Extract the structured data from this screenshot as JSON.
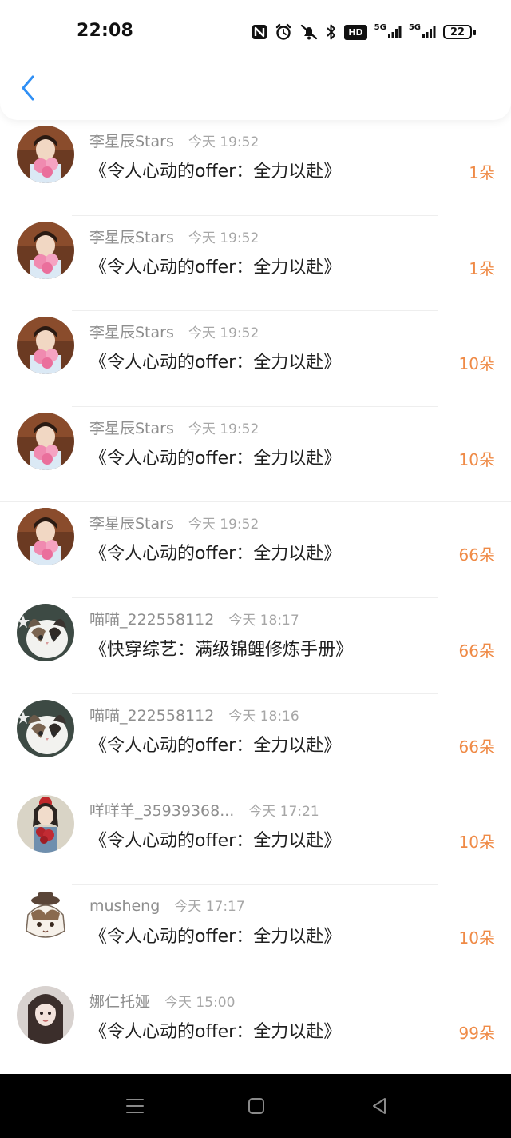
{
  "status_bar": {
    "time": "22:08",
    "icons": [
      "nfc-icon",
      "alarm-icon",
      "mute-icon",
      "bluetooth-icon",
      "hd-icon",
      "5g-signal-icon",
      "5g-signal-icon",
      "battery-icon"
    ],
    "hd_text": "HD",
    "net1_text": "5G",
    "net2_text": "5G",
    "battery_level": "22"
  },
  "nav": {
    "back_icon": "chevron-left-icon",
    "accent_color": "#2f8ff5"
  },
  "colors": {
    "count": "#ef8a46",
    "username": "#8e8e8e",
    "time": "#a6a6a6"
  },
  "rows": [
    {
      "user": "李星辰Stars",
      "time": "今天 19:52",
      "title": "《令人心动的offer：全力以赴》",
      "count": "1朵"
    },
    {
      "user": "李星辰Stars",
      "time": "今天 19:52",
      "title": "《令人心动的offer：全力以赴》",
      "count": "1朵"
    },
    {
      "user": "李星辰Stars",
      "time": "今天 19:52",
      "title": "《令人心动的offer：全力以赴》",
      "count": "10朵"
    },
    {
      "user": "李星辰Stars",
      "time": "今天 19:52",
      "title": "《令人心动的offer：全力以赴》",
      "count": "10朵"
    },
    {
      "user": "李星辰Stars",
      "time": "今天 19:52",
      "title": "《令人心动的offer：全力以赴》",
      "count": "66朵"
    },
    {
      "user": "喵喵_222558112",
      "time": "今天 18:17",
      "title": "《快穿综艺：满级锦鲤修炼手册》",
      "count": "66朵"
    },
    {
      "user": "喵喵_222558112",
      "time": "今天 18:16",
      "title": "《令人心动的offer：全力以赴》",
      "count": "66朵"
    },
    {
      "user": "咩咩羊_35939368...",
      "time": "今天 17:21",
      "title": "《令人心动的offer：全力以赴》",
      "count": "10朵"
    },
    {
      "user": "musheng",
      "time": "今天 17:17",
      "title": "《令人心动的offer：全力以赴》",
      "count": "10朵"
    },
    {
      "user": "娜仁托娅",
      "time": "今天 15:00",
      "title": "《令人心动的offer：全力以赴》",
      "count": "99朵"
    }
  ],
  "system_nav": {
    "icons": [
      "menu-icon",
      "home-icon",
      "back-triangle-icon"
    ]
  }
}
